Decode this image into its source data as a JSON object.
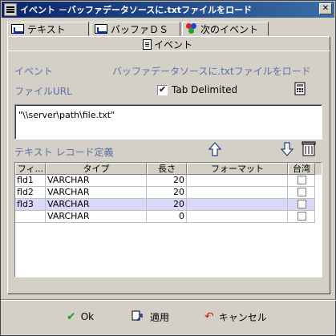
{
  "window": {
    "title": "イベント －バッファデータソースに.txtファイルをロード"
  },
  "tabs": [
    {
      "label": "テキスト",
      "icon": "chart-icon"
    },
    {
      "label": "バッファＤＳ",
      "icon": "chart-icon"
    },
    {
      "label": "次のイベント",
      "icon": "dots-icon"
    }
  ],
  "subtab": {
    "label": "イベント",
    "icon": "document-icon"
  },
  "form": {
    "event_label": "イベント",
    "event_value": "バッファデータソースに.txtファイルをロード",
    "file_url_label": "ファイルURL",
    "tab_delimited_label": "Tab Delimited",
    "tab_delimited_checked": true,
    "file_path": "\"\\\\server\\path\\file.txt\"",
    "record_def_label": "テキスト レコード定義"
  },
  "grid": {
    "columns": [
      "フィ...",
      "タイプ",
      "長さ",
      "フォーマット",
      "台湾"
    ],
    "rows": [
      {
        "field": "fld1",
        "type": "VARCHAR",
        "length": "20",
        "format": "",
        "taiwan": false
      },
      {
        "field": "fld2",
        "type": "VARCHAR",
        "length": "20",
        "format": "",
        "taiwan": false
      },
      {
        "field": "fld3",
        "type": "VARCHAR",
        "length": "20",
        "format": "",
        "taiwan": false,
        "selected": true
      },
      {
        "field": "",
        "type": "VARCHAR",
        "length": "0",
        "format": "",
        "taiwan": false
      }
    ]
  },
  "buttons": {
    "ok": "Ok",
    "apply": "適用",
    "cancel": "キャンセル"
  },
  "colors": {
    "title_start": "#0a246a",
    "title_end": "#3a6ea5",
    "label_blue": "#5a72a8",
    "selected_row": "#d8d8f8",
    "ok_green": "#2a9a2a",
    "cancel_red": "#cc2020"
  }
}
